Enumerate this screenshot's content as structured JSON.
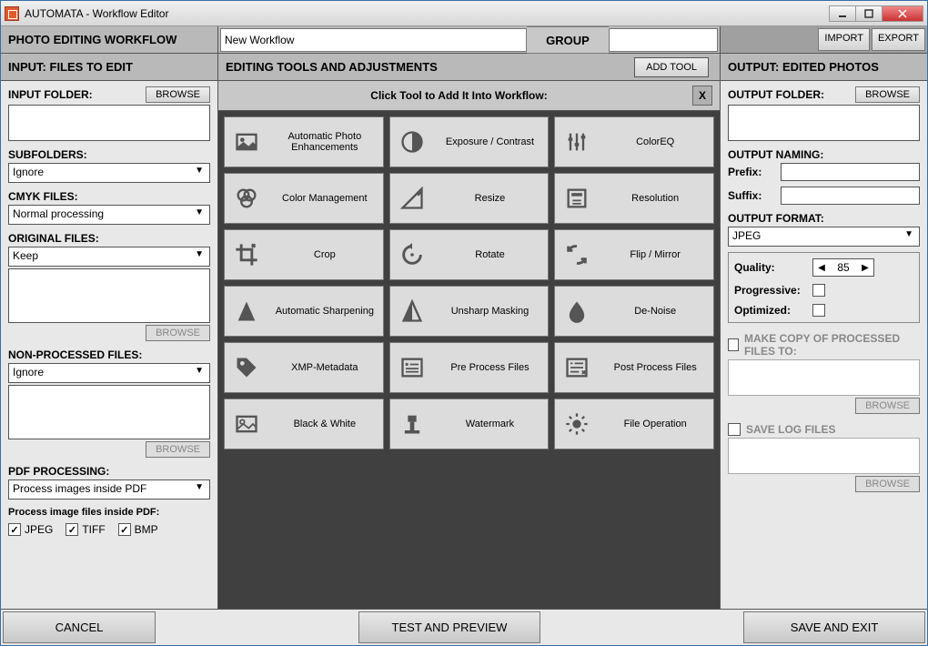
{
  "window": {
    "title": "AUTOMATA - Workflow Editor"
  },
  "header": {
    "workflow_label": "PHOTO EDITING WORKFLOW",
    "workflow_name": "New Workflow",
    "group_label": "GROUP",
    "group_value": "",
    "import": "IMPORT",
    "export": "EXPORT"
  },
  "second_row": {
    "input_label": "INPUT: FILES TO EDIT",
    "tools_label": "EDITING TOOLS AND ADJUSTMENTS",
    "add_tool": "ADD TOOL",
    "output_label": "OUTPUT: EDITED PHOTOS"
  },
  "input": {
    "folder_label": "INPUT FOLDER:",
    "folder_value": "",
    "browse": "BROWSE",
    "subfolders_label": "SUBFOLDERS:",
    "subfolders_value": "Ignore",
    "cmyk_label": "CMYK FILES:",
    "cmyk_value": "Normal  processing",
    "original_label": "ORIGINAL FILES:",
    "original_value": "Keep",
    "original_dest": "",
    "nonproc_label": "NON-PROCESSED FILES:",
    "nonproc_value": "Ignore",
    "nonproc_dest": "",
    "pdf_label": "PDF PROCESSING:",
    "pdf_value": "Process images inside PDF",
    "pdf_sub": "Process image files inside PDF:",
    "jpeg": "JPEG",
    "tiff": "TIFF",
    "bmp": "BMP"
  },
  "tools": {
    "title": "Click Tool to Add It Into Workflow:",
    "items": [
      "Automatic Photo Enhancements",
      "Exposure / Contrast",
      "ColorEQ",
      "Color Management",
      "Resize",
      "Resolution",
      "Crop",
      "Rotate",
      "Flip / Mirror",
      "Automatic Sharpening",
      "Unsharp Masking",
      "De-Noise",
      "XMP-Metadata",
      "Pre Process Files",
      "Post Process Files",
      "Black & White",
      "Watermark",
      "File Operation"
    ]
  },
  "output": {
    "folder_label": "OUTPUT FOLDER:",
    "folder_value": "",
    "browse": "BROWSE",
    "naming_label": "OUTPUT NAMING:",
    "prefix_label": "Prefix:",
    "prefix_value": "",
    "suffix_label": "Suffix:",
    "suffix_value": "",
    "format_label": "OUTPUT FORMAT:",
    "format_value": "JPEG",
    "quality_label": "Quality:",
    "quality_value": "85",
    "progressive_label": "Progressive:",
    "optimized_label": "Optimized:",
    "makecopy_label": "MAKE COPY OF PROCESSED FILES TO:",
    "savelog_label": "SAVE LOG FILES"
  },
  "bottom": {
    "cancel": "CANCEL",
    "test": "TEST AND PREVIEW",
    "save": "SAVE AND EXIT"
  }
}
